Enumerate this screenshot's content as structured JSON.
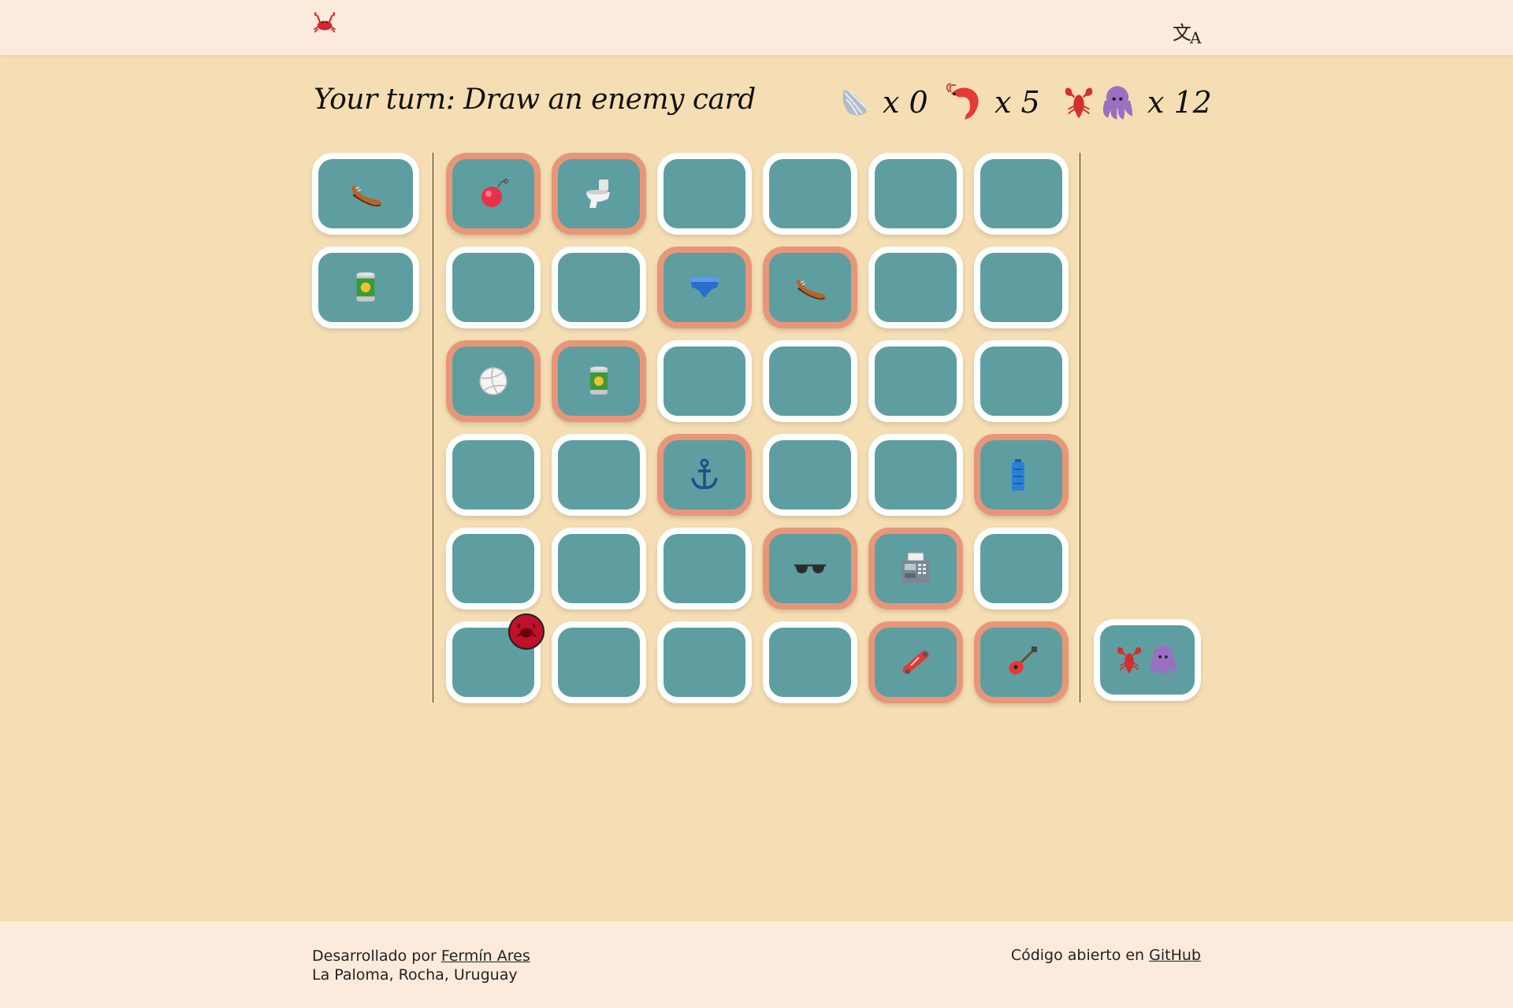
{
  "header": {
    "logo_icon": "crab-icon",
    "translate_icon": "translate-icon",
    "translate_glyph_a": "文",
    "translate_glyph_b": "A"
  },
  "status": {
    "title": "Your turn: Draw an enemy card"
  },
  "counters": [
    {
      "icon": "shell-icon",
      "label": "x 0"
    },
    {
      "icon": "shrimp-icon",
      "label": "x 5"
    },
    {
      "icon": "lobster-octopus-icon",
      "label": "x 12"
    }
  ],
  "hand": [
    "shoe-icon",
    "canned-food-icon"
  ],
  "board": [
    [
      "yoyo-icon",
      "toilet-icon",
      "",
      "",
      "",
      ""
    ],
    [
      "",
      "",
      "briefs-icon",
      "shoe-icon",
      "",
      ""
    ],
    [
      "volleyball-icon",
      "canned-food-icon",
      "",
      "",
      "",
      ""
    ],
    [
      "",
      "",
      "anchor-icon",
      "",
      "",
      "battery-icon"
    ],
    [
      "",
      "",
      "",
      "sunglasses-icon",
      "fax-icon",
      ""
    ],
    [
      "",
      "",
      "",
      "",
      "skateboard-icon",
      "guitar-icon"
    ]
  ],
  "revealed": [
    [
      true,
      true,
      false,
      false,
      false,
      false
    ],
    [
      false,
      false,
      true,
      true,
      false,
      false
    ],
    [
      true,
      true,
      false,
      false,
      false,
      false
    ],
    [
      false,
      false,
      true,
      false,
      false,
      true
    ],
    [
      false,
      false,
      false,
      true,
      true,
      false
    ],
    [
      false,
      false,
      false,
      false,
      true,
      true
    ]
  ],
  "marker": {
    "row": 5,
    "col": 0,
    "icon": "crab-marker-icon"
  },
  "enemy_deck": {
    "icon": "lobster-octopus-icon"
  },
  "colors": {
    "background": "#f5deb3",
    "header": "#fcebdc",
    "card": "#5f9ea0",
    "card_border": "#ffffff",
    "hit_border": "#e8967a",
    "marker": "#c0102a"
  },
  "footer": {
    "dev_prefix": "Desarrollado por",
    "dev_name": "Fermín Ares",
    "location": "La Paloma, Rocha, Uruguay",
    "code_prefix": "Código abierto en",
    "code_link": "GitHub"
  }
}
